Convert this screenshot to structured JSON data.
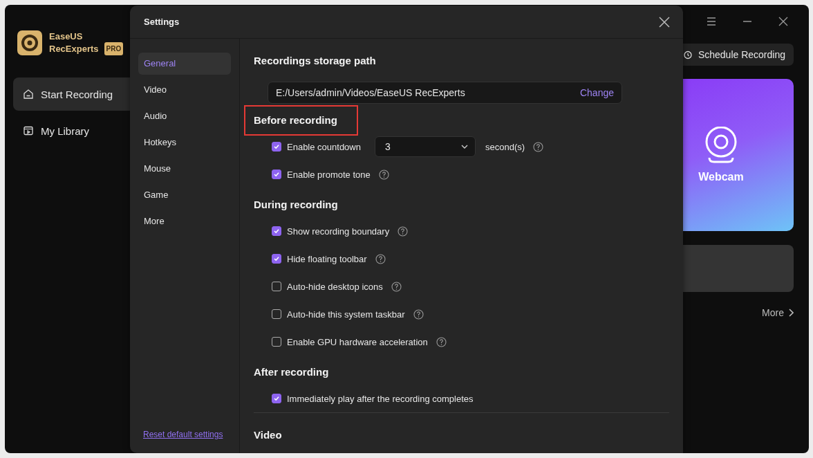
{
  "app": {
    "name_line1": "EaseUS",
    "name_line2": "RecExperts",
    "badge": "PRO",
    "nav": [
      {
        "label": "Start Recording",
        "selected": true
      },
      {
        "label": "My Library",
        "selected": false
      }
    ],
    "schedule_button": "Schedule Recording",
    "webcam_card": "Webcam",
    "more_link": "More"
  },
  "settings": {
    "title": "Settings",
    "tabs": [
      {
        "label": "General",
        "selected": true
      },
      {
        "label": "Video",
        "selected": false
      },
      {
        "label": "Audio",
        "selected": false
      },
      {
        "label": "Hotkeys",
        "selected": false
      },
      {
        "label": "Mouse",
        "selected": false
      },
      {
        "label": "Game",
        "selected": false
      },
      {
        "label": "More",
        "selected": false
      }
    ],
    "reset_link": "Reset default settings",
    "storage": {
      "title": "Recordings storage path",
      "path": "E:/Users/admin/Videos/EaseUS RecExperts",
      "change": "Change"
    },
    "sections": [
      {
        "title": "Before recording",
        "highlighted": true,
        "divider": false,
        "options": [
          {
            "kind": "countdown",
            "label": "Enable countdown",
            "checked": true,
            "value": "3",
            "unit": "second(s)",
            "help": true
          },
          {
            "kind": "checkbox",
            "label": "Enable promote tone",
            "checked": true,
            "help": true
          }
        ]
      },
      {
        "title": "During recording",
        "highlighted": false,
        "divider": false,
        "options": [
          {
            "kind": "checkbox",
            "label": "Show recording boundary",
            "checked": true,
            "help": true
          },
          {
            "kind": "checkbox",
            "label": "Hide floating toolbar",
            "checked": true,
            "help": true
          },
          {
            "kind": "checkbox",
            "label": "Auto-hide desktop icons",
            "checked": false,
            "help": true
          },
          {
            "kind": "checkbox",
            "label": "Auto-hide this system taskbar",
            "checked": false,
            "help": true
          },
          {
            "kind": "checkbox",
            "label": "Enable GPU hardware acceleration",
            "checked": false,
            "help": true
          }
        ]
      },
      {
        "title": "After recording",
        "highlighted": false,
        "divider": false,
        "options": [
          {
            "kind": "checkbox",
            "label": "Immediately play after the recording completes",
            "checked": true,
            "help": false
          }
        ]
      },
      {
        "title": "Video",
        "highlighted": false,
        "divider": true
      }
    ]
  }
}
